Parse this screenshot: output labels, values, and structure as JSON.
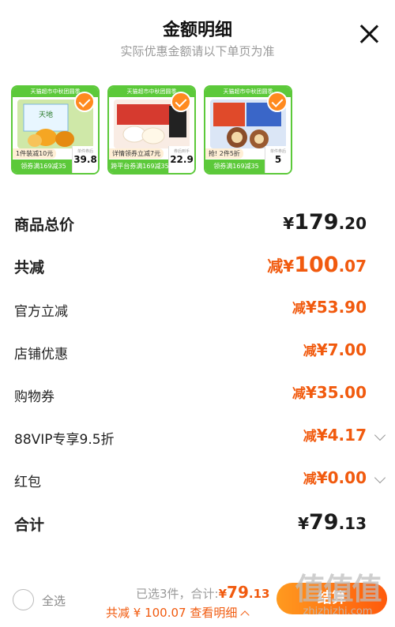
{
  "header": {
    "title": "金额明细",
    "subtitle": "实际优惠金额请以下单页为准"
  },
  "products": [
    {
      "banner": "天猫超市中秋团圆季",
      "tag": "1件装减10元",
      "coupon": "领券满169减35",
      "price_label": "单件券后",
      "price": "39.8",
      "colors": {
        "bg": "#cfe8a8",
        "accent": "#f5a623"
      }
    },
    {
      "banner": "天猫超市中秋团圆季",
      "tag": "详情领券立减7元",
      "coupon": "跨平台券满169减35",
      "price_label": "券后到手",
      "price": "22.9",
      "colors": {
        "bg": "#f4d6c8",
        "accent": "#e33"
      }
    },
    {
      "banner": "天猫超市中秋团圆季",
      "tag": "抢! 2件5折",
      "coupon": "领券满169减35",
      "price_label": "单件券后",
      "price": "5",
      "colors": {
        "bg": "#b6c9e8",
        "accent": "#8a4d2a"
      }
    }
  ],
  "rows": [
    {
      "label": "商品总价",
      "currency": "¥",
      "int": "179",
      "dec": ".20",
      "style": "black-bold"
    },
    {
      "label": "共减",
      "prefix": "减",
      "currency": "¥",
      "int": "100",
      "dec": ".07",
      "style": "orange-bold"
    },
    {
      "label": "官方立减",
      "prefix": "减",
      "currency": "¥",
      "amount": "53.90"
    },
    {
      "label": "店铺优惠",
      "prefix": "减",
      "currency": "¥",
      "amount": "7.00"
    },
    {
      "label": "购物券",
      "prefix": "减",
      "currency": "¥",
      "amount": "35.00"
    },
    {
      "label": "88VIP专享9.5折",
      "prefix": "减",
      "currency": "¥",
      "amount": "4.17"
    },
    {
      "label": "红包",
      "prefix": "减",
      "currency": "¥",
      "amount": "0.00"
    },
    {
      "label": "合计",
      "currency": "¥",
      "int": "79",
      "dec": ".13"
    }
  ],
  "footer": {
    "select_all": "全选",
    "selected_prefix": "已选3件，合计:",
    "selected_currency": "¥",
    "selected_int": "79",
    "selected_dec": ".13",
    "reduce_text": "共减 ¥ 100.07 查看明细",
    "checkout": "结算"
  },
  "watermark": {
    "logo": "值值值",
    "url": "zhizhizhi.com"
  },
  "colors": {
    "accent_orange": "#f15a0e",
    "check_orange": "#ff8a1f",
    "thumb_green": "#5cc93a"
  }
}
